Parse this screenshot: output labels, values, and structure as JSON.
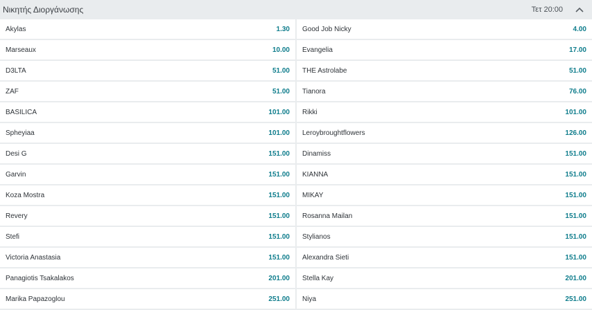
{
  "header": {
    "title": "Νικητής Διοργάνωσης",
    "time": "Τετ 20:00"
  },
  "selections": [
    {
      "left": {
        "name": "Akylas",
        "odds": "1.30"
      },
      "right": {
        "name": "Good Job Nicky",
        "odds": "4.00"
      }
    },
    {
      "left": {
        "name": "Marseaux",
        "odds": "10.00"
      },
      "right": {
        "name": "Evangelia",
        "odds": "17.00"
      }
    },
    {
      "left": {
        "name": "D3LTA",
        "odds": "51.00"
      },
      "right": {
        "name": "THE Astrolabe",
        "odds": "51.00"
      }
    },
    {
      "left": {
        "name": "ZAF",
        "odds": "51.00"
      },
      "right": {
        "name": "Tianora",
        "odds": "76.00"
      }
    },
    {
      "left": {
        "name": "BASILICA",
        "odds": "101.00"
      },
      "right": {
        "name": "Rikki",
        "odds": "101.00"
      }
    },
    {
      "left": {
        "name": "Spheyiaa",
        "odds": "101.00"
      },
      "right": {
        "name": "Leroybroughtflowers",
        "odds": "126.00"
      }
    },
    {
      "left": {
        "name": "Desi G",
        "odds": "151.00"
      },
      "right": {
        "name": "Dinamiss",
        "odds": "151.00"
      }
    },
    {
      "left": {
        "name": "Garvin",
        "odds": "151.00"
      },
      "right": {
        "name": "KIANNA",
        "odds": "151.00"
      }
    },
    {
      "left": {
        "name": "Koza Mostra",
        "odds": "151.00"
      },
      "right": {
        "name": "MIKAY",
        "odds": "151.00"
      }
    },
    {
      "left": {
        "name": "Revery",
        "odds": "151.00"
      },
      "right": {
        "name": "Rosanna Mailan",
        "odds": "151.00"
      }
    },
    {
      "left": {
        "name": "Stefi",
        "odds": "151.00"
      },
      "right": {
        "name": "Stylianos",
        "odds": "151.00"
      }
    },
    {
      "left": {
        "name": "Victoria Anastasia",
        "odds": "151.00"
      },
      "right": {
        "name": "Alexandra Sieti",
        "odds": "151.00"
      }
    },
    {
      "left": {
        "name": "Panagiotis Tsakalakos",
        "odds": "201.00"
      },
      "right": {
        "name": "Stella Kay",
        "odds": "201.00"
      }
    },
    {
      "left": {
        "name": "Marika Papazoglou",
        "odds": "251.00"
      },
      "right": {
        "name": "Niya",
        "odds": "251.00"
      }
    }
  ],
  "colors": {
    "odds": "#0f7d8c",
    "background": "#e9ecee"
  },
  "icons": {
    "collapse": "chevron-up-icon"
  }
}
